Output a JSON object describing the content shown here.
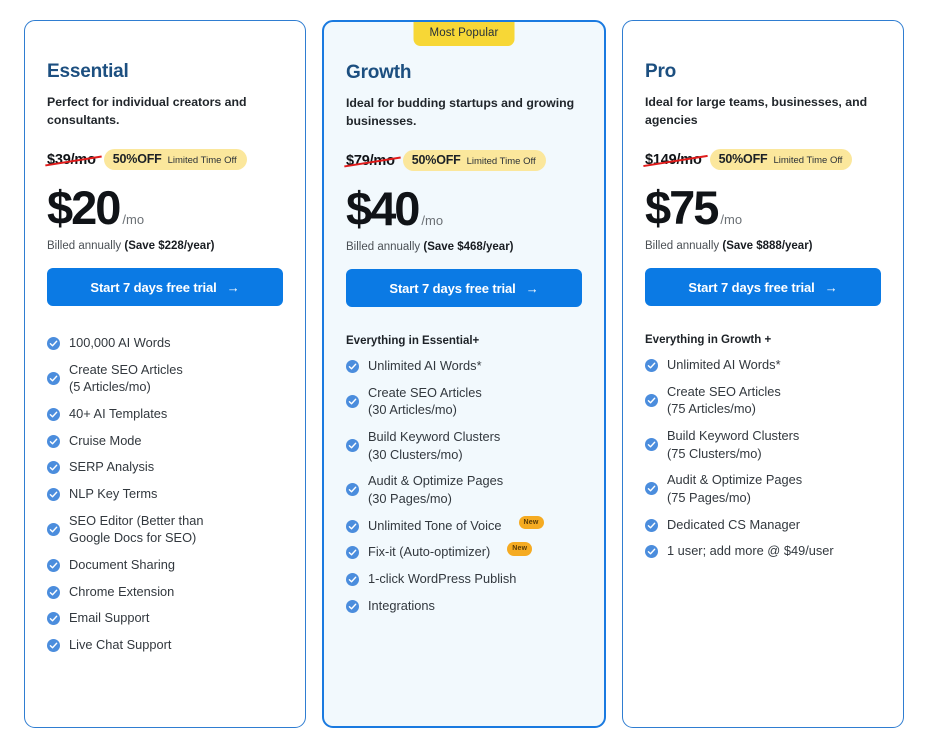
{
  "plans": [
    {
      "name": "Essential",
      "description": "Perfect for individual creators and consultants.",
      "popular_badge": "",
      "old_price": "$39/mo",
      "discount_pct": "50%OFF",
      "discount_note": "Limited Time Off",
      "price": "$20",
      "price_period": "/mo",
      "billed_prefix": "Billed annually ",
      "billed_save": "(Save $228/year)",
      "cta_label": "Start 7 days free trial",
      "cta_arrow": "→",
      "includes_label": "",
      "features": [
        {
          "text": "100,000 AI Words",
          "badge": ""
        },
        {
          "text": "Create SEO Articles\n(5 Articles/mo)",
          "badge": ""
        },
        {
          "text": "40+ AI Templates",
          "badge": ""
        },
        {
          "text": "Cruise Mode",
          "badge": ""
        },
        {
          "text": "SERP Analysis",
          "badge": ""
        },
        {
          "text": "NLP Key Terms",
          "badge": ""
        },
        {
          "text": "SEO Editor (Better than\nGoogle Docs for SEO)",
          "badge": ""
        },
        {
          "text": "Document Sharing",
          "badge": ""
        },
        {
          "text": "Chrome Extension",
          "badge": ""
        },
        {
          "text": "Email Support",
          "badge": ""
        },
        {
          "text": "Live Chat Support",
          "badge": ""
        }
      ]
    },
    {
      "name": "Growth",
      "description": "Ideal for budding startups and growing businesses.",
      "popular_badge": "Most Popular",
      "old_price": "$79/mo",
      "discount_pct": "50%OFF",
      "discount_note": "Limited Time Off",
      "price": "$40",
      "price_period": "/mo",
      "billed_prefix": "Billed annually ",
      "billed_save": "(Save $468/year)",
      "cta_label": "Start 7 days free trial",
      "cta_arrow": "→",
      "includes_label": "Everything in Essential+",
      "features": [
        {
          "text": "Unlimited AI Words*",
          "badge": ""
        },
        {
          "text": "Create SEO Articles\n(30 Articles/mo)",
          "badge": ""
        },
        {
          "text": "Build Keyword Clusters\n(30 Clusters/mo)",
          "badge": ""
        },
        {
          "text": "Audit & Optimize Pages\n(30 Pages/mo)",
          "badge": ""
        },
        {
          "text": "Unlimited Tone of Voice",
          "badge": "New"
        },
        {
          "text": "Fix-it (Auto-optimizer)",
          "badge": "New"
        },
        {
          "text": "1-click WordPress Publish",
          "badge": ""
        },
        {
          "text": "Integrations",
          "badge": ""
        }
      ]
    },
    {
      "name": "Pro",
      "description": "Ideal for large teams, businesses, and agencies",
      "popular_badge": "",
      "old_price": "$149/mo",
      "discount_pct": "50%OFF",
      "discount_note": "Limited Time Off",
      "price": "$75",
      "price_period": "/mo",
      "billed_prefix": "Billed annually ",
      "billed_save": "(Save $888/year)",
      "cta_label": "Start 7 days free trial",
      "cta_arrow": "→",
      "includes_label": "Everything in Growth +",
      "features": [
        {
          "text": "Unlimited AI Words*",
          "badge": ""
        },
        {
          "text": "Create SEO Articles\n(75 Articles/mo)",
          "badge": ""
        },
        {
          "text": "Build Keyword Clusters\n(75 Clusters/mo)",
          "badge": ""
        },
        {
          "text": "Audit & Optimize Pages\n(75 Pages/mo)",
          "badge": ""
        },
        {
          "text": "Dedicated CS Manager",
          "badge": ""
        },
        {
          "text": "1 user; add more @ $49/user",
          "badge": ""
        }
      ]
    }
  ],
  "colors": {
    "accent_blue": "#0b7ae4",
    "title_blue": "#1c4f80",
    "card_border": "#2f7dd1",
    "featured_bg": "#f2f9fd",
    "badge_yellow": "#f7d736",
    "discount_yellow": "#fbe79c",
    "new_badge_orange": "#f5ab22",
    "strike_red": "#e01b1b"
  }
}
